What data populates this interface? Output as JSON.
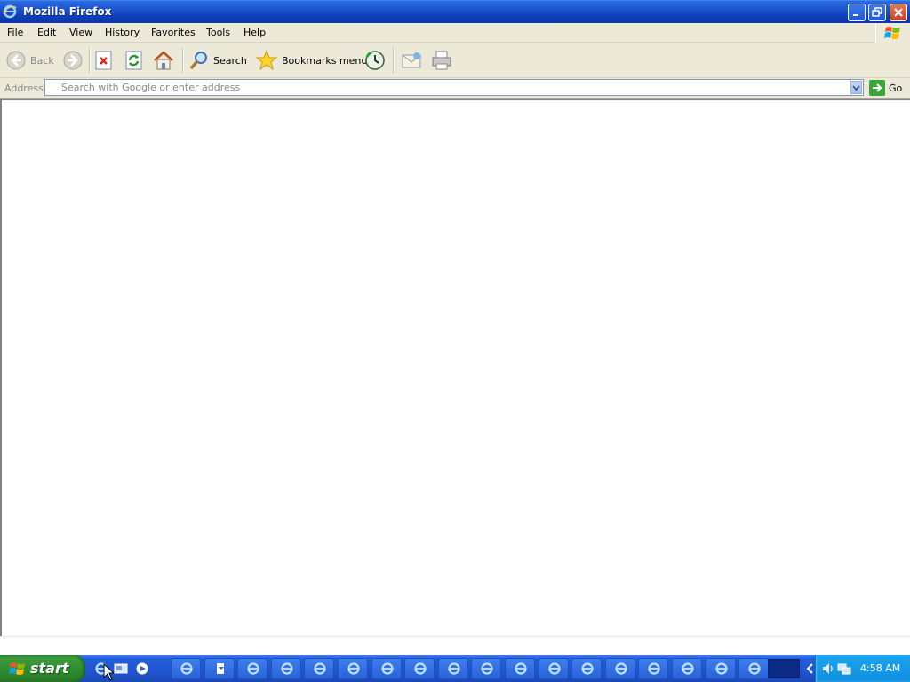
{
  "window": {
    "title": "Mozilla Firefox"
  },
  "menu": [
    "File",
    "Edit",
    "View",
    "History",
    "Favorites",
    "Tools",
    "Help"
  ],
  "toolbar": {
    "back_label": "Back",
    "search_label": "Search",
    "bookmarks_label": "Bookmarks menu"
  },
  "address": {
    "label": "Address",
    "placeholder": "Search with Google or enter address",
    "value": "",
    "go_label": "Go"
  },
  "taskbar": {
    "start_label": "start",
    "clock": "4:58 AM",
    "window_button_count": 18
  },
  "colors": {
    "titlebar": "#1f57d6",
    "chrome": "#ece9d8",
    "start_green": "#3c9a3c",
    "taskbar_blue": "#245edb",
    "tray_blue": "#1290e0"
  }
}
